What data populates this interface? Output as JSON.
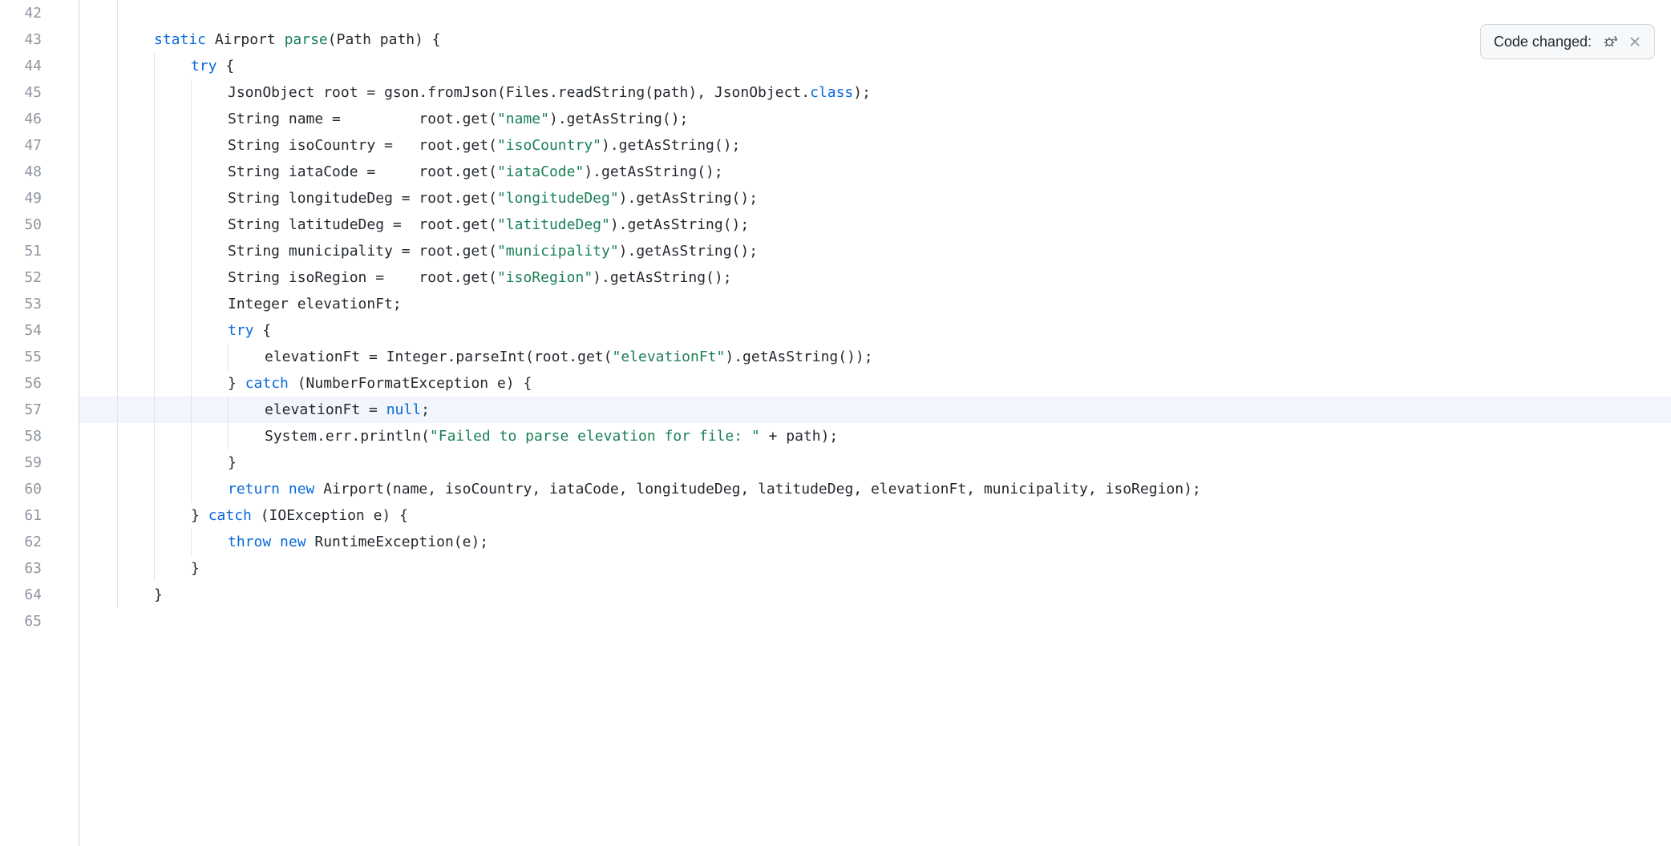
{
  "notification": {
    "label": "Code changed:"
  },
  "gutter": {
    "start": 42,
    "end": 65,
    "highlighted": 57
  },
  "code": {
    "lines": [
      {
        "n": 42,
        "indent": 1,
        "tokens": []
      },
      {
        "n": 43,
        "indent": 1,
        "tokens": [
          {
            "c": "keyword",
            "t": "static"
          },
          {
            "c": "plain",
            "t": " Airport "
          },
          {
            "c": "method",
            "t": "parse"
          },
          {
            "c": "plain",
            "t": "(Path path) {"
          }
        ]
      },
      {
        "n": 44,
        "indent": 2,
        "tokens": [
          {
            "c": "keyword",
            "t": "try"
          },
          {
            "c": "plain",
            "t": " {"
          }
        ]
      },
      {
        "n": 45,
        "indent": 3,
        "tokens": [
          {
            "c": "plain",
            "t": "JsonObject root = gson.fromJson(Files.readString(path), JsonObject."
          },
          {
            "c": "keyword",
            "t": "class"
          },
          {
            "c": "plain",
            "t": ");"
          }
        ]
      },
      {
        "n": 46,
        "indent": 3,
        "tokens": [
          {
            "c": "plain",
            "t": "String name =         root.get("
          },
          {
            "c": "string",
            "t": "\"name\""
          },
          {
            "c": "plain",
            "t": ").getAsString();"
          }
        ]
      },
      {
        "n": 47,
        "indent": 3,
        "tokens": [
          {
            "c": "plain",
            "t": "String isoCountry =   root.get("
          },
          {
            "c": "string",
            "t": "\"isoCountry\""
          },
          {
            "c": "plain",
            "t": ").getAsString();"
          }
        ]
      },
      {
        "n": 48,
        "indent": 3,
        "tokens": [
          {
            "c": "plain",
            "t": "String iataCode =     root.get("
          },
          {
            "c": "string",
            "t": "\"iataCode\""
          },
          {
            "c": "plain",
            "t": ").getAsString();"
          }
        ]
      },
      {
        "n": 49,
        "indent": 3,
        "tokens": [
          {
            "c": "plain",
            "t": "String longitudeDeg = root.get("
          },
          {
            "c": "string",
            "t": "\"longitudeDeg\""
          },
          {
            "c": "plain",
            "t": ").getAsString();"
          }
        ]
      },
      {
        "n": 50,
        "indent": 3,
        "tokens": [
          {
            "c": "plain",
            "t": "String latitudeDeg =  root.get("
          },
          {
            "c": "string",
            "t": "\"latitudeDeg\""
          },
          {
            "c": "plain",
            "t": ").getAsString();"
          }
        ]
      },
      {
        "n": 51,
        "indent": 3,
        "tokens": [
          {
            "c": "plain",
            "t": "String municipality = root.get("
          },
          {
            "c": "string",
            "t": "\"municipality\""
          },
          {
            "c": "plain",
            "t": ").getAsString();"
          }
        ]
      },
      {
        "n": 52,
        "indent": 3,
        "tokens": [
          {
            "c": "plain",
            "t": "String isoRegion =    root.get("
          },
          {
            "c": "string",
            "t": "\"isoRegion\""
          },
          {
            "c": "plain",
            "t": ").getAsString();"
          }
        ]
      },
      {
        "n": 53,
        "indent": 3,
        "tokens": [
          {
            "c": "plain",
            "t": "Integer elevationFt;"
          }
        ]
      },
      {
        "n": 54,
        "indent": 3,
        "tokens": [
          {
            "c": "keyword",
            "t": "try"
          },
          {
            "c": "plain",
            "t": " {"
          }
        ]
      },
      {
        "n": 55,
        "indent": 4,
        "tokens": [
          {
            "c": "plain",
            "t": "elevationFt = Integer.parseInt(root.get("
          },
          {
            "c": "string",
            "t": "\"elevationFt\""
          },
          {
            "c": "plain",
            "t": ").getAsString());"
          }
        ]
      },
      {
        "n": 56,
        "indent": 3,
        "tokens": [
          {
            "c": "plain",
            "t": "} "
          },
          {
            "c": "keyword",
            "t": "catch"
          },
          {
            "c": "plain",
            "t": " (NumberFormatException e) {"
          }
        ]
      },
      {
        "n": 57,
        "indent": 4,
        "highlighted": true,
        "tokens": [
          {
            "c": "plain",
            "t": "elevationFt = "
          },
          {
            "c": "null",
            "t": "null"
          },
          {
            "c": "plain",
            "t": ";"
          }
        ]
      },
      {
        "n": 58,
        "indent": 4,
        "tokens": [
          {
            "c": "plain",
            "t": "System.err.println("
          },
          {
            "c": "string",
            "t": "\"Failed to parse elevation for file: \""
          },
          {
            "c": "plain",
            "t": " + path);"
          }
        ]
      },
      {
        "n": 59,
        "indent": 3,
        "tokens": [
          {
            "c": "plain",
            "t": "}"
          }
        ]
      },
      {
        "n": 60,
        "indent": 3,
        "tokens": [
          {
            "c": "keyword",
            "t": "return"
          },
          {
            "c": "plain",
            "t": " "
          },
          {
            "c": "keyword",
            "t": "new"
          },
          {
            "c": "plain",
            "t": " Airport(name, isoCountry, iataCode, longitudeDeg, latitudeDeg, elevationFt, municipality, isoRegion);"
          }
        ]
      },
      {
        "n": 61,
        "indent": 2,
        "tokens": [
          {
            "c": "plain",
            "t": "} "
          },
          {
            "c": "keyword",
            "t": "catch"
          },
          {
            "c": "plain",
            "t": " (IOException e) {"
          }
        ]
      },
      {
        "n": 62,
        "indent": 3,
        "tokens": [
          {
            "c": "keyword",
            "t": "throw"
          },
          {
            "c": "plain",
            "t": " "
          },
          {
            "c": "keyword",
            "t": "new"
          },
          {
            "c": "plain",
            "t": " RuntimeException(e);"
          }
        ]
      },
      {
        "n": 63,
        "indent": 2,
        "tokens": [
          {
            "c": "plain",
            "t": "}"
          }
        ]
      },
      {
        "n": 64,
        "indent": 1,
        "tokens": [
          {
            "c": "plain",
            "t": "}"
          }
        ]
      },
      {
        "n": 65,
        "indent": 0,
        "tokens": []
      }
    ],
    "indentUnit": "    "
  }
}
